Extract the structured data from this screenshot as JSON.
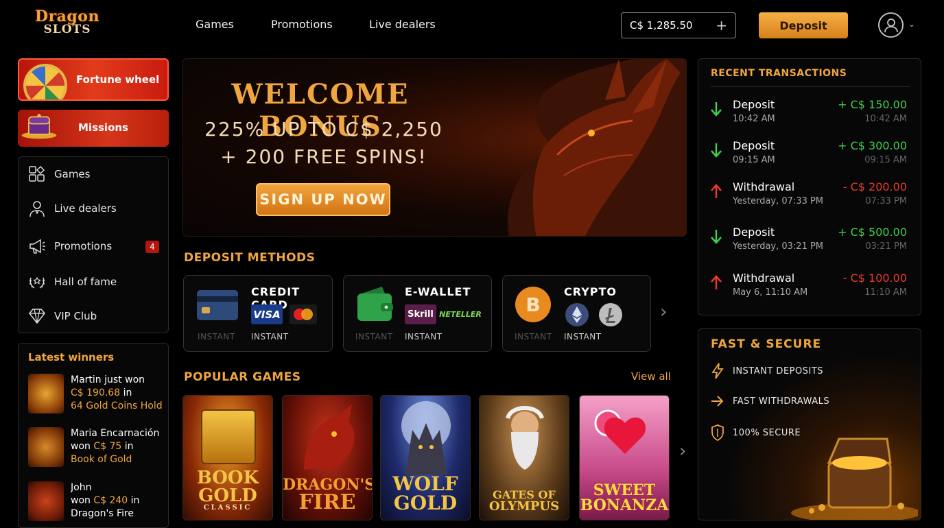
{
  "header": {
    "logo_line1": "Dragon",
    "logo_line2": "SLOTS",
    "nav": [
      "Games",
      "Promotions",
      "Live dealers"
    ],
    "balance": "C$ 1,285.50",
    "deposit_label": "Deposit"
  },
  "sidebar": {
    "fortune_wheel": "Fortune wheel",
    "missions": "Missions",
    "items": [
      {
        "label": "Games",
        "icon": "games-icon"
      },
      {
        "label": "Live dealers",
        "icon": "live-dealer-icon"
      },
      {
        "label": "Promotions",
        "icon": "megaphone-icon",
        "badge": "4"
      },
      {
        "label": "Hall of fame",
        "icon": "laurel-icon"
      },
      {
        "label": "VIP Club",
        "icon": "diamond-icon"
      }
    ]
  },
  "winners": {
    "title": "Latest winners",
    "rows": [
      {
        "name": "Martin",
        "won": "just won",
        "amount": "C$ 190.68",
        "in": "in",
        "game": "64 Gold Coins Hold"
      },
      {
        "name": "Maria Encarnación",
        "won": "won",
        "amount": "C$ 75",
        "in": "in",
        "game": "Book of Gold"
      },
      {
        "name": "John",
        "won": "won",
        "amount": "C$ 240",
        "in": "in",
        "game": "Dragon's Fire"
      }
    ]
  },
  "hero": {
    "title": "WELCOME BONUS",
    "line1": "225% UP TO C$ 2,250",
    "line2": "+ 200 FREE SPINS!",
    "cta": "SIGN UP NOW"
  },
  "deposit_methods": {
    "title": "DEPOSIT METHODS",
    "cards": [
      {
        "name": "CREDIT CARD",
        "tag_ghost": "INSTANT",
        "tag": "INSTANT",
        "logos": [
          "VISA"
        ]
      },
      {
        "name": "E-WALLET",
        "tag_ghost": "INSTANT",
        "tag": "INSTANT",
        "logos": [
          "Skrill",
          "NETELLER"
        ]
      },
      {
        "name": "CRYPTO",
        "tag_ghost": "INSTANT",
        "tag": "INSTANT",
        "logos": []
      }
    ]
  },
  "popular_games": {
    "title": "POPULAR GAMES",
    "view_all": "View all",
    "games": [
      {
        "line1": "BOOK",
        "line2": "GOLD",
        "line3": "CLASSIC"
      },
      {
        "line1": "DRAGON'S",
        "line2": "FIRE",
        "line3": ""
      },
      {
        "line1": "WOLF",
        "line2": "GOLD",
        "line3": ""
      },
      {
        "line1": "GATES OF",
        "line2": "OLYMPUS",
        "line3": ""
      },
      {
        "line1": "SWEET",
        "line2": "BONANZA",
        "line3": ""
      }
    ]
  },
  "transactions": {
    "title": "RECENT TRANSACTIONS",
    "rows": [
      {
        "type": "Deposit",
        "time": "10:42 AM",
        "amount": "+ C$ 150.00",
        "time2": "10:42 AM",
        "direction": "in"
      },
      {
        "type": "Deposit",
        "time": "09:15 AM",
        "amount": "+ C$ 300.00",
        "time2": "09:15 AM",
        "direction": "in"
      },
      {
        "type": "Withdrawal",
        "time": "Yesterday, 07:33 PM",
        "amount": "- C$ 200.00",
        "time2": "07:33 PM",
        "direction": "out"
      },
      {
        "type": "Deposit",
        "time": "Yesterday, 03:21 PM",
        "amount": "+ C$ 500.00",
        "time2": "03:21 PM",
        "direction": "in"
      },
      {
        "type": "Withdrawal",
        "time": "May 6, 11:10 AM",
        "amount": "- C$ 100.00",
        "time2": "11:10 AM",
        "direction": "out"
      }
    ]
  },
  "fast_secure": {
    "title": "FAST & SECURE",
    "items": [
      "INSTANT DEPOSITS",
      "FAST WITHDRAWALS",
      "100% SECURE"
    ]
  },
  "colors": {
    "accent": "#f0a640",
    "positive": "#3fcf4a",
    "negative": "#e8392a",
    "promo_red": "#d5351a"
  }
}
